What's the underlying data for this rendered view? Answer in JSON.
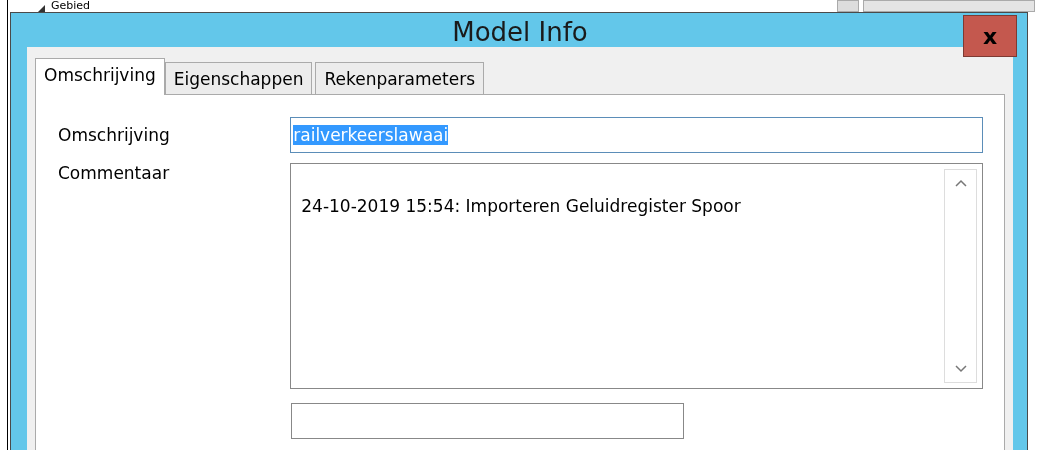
{
  "background": {
    "tree_item": "Gebied"
  },
  "window": {
    "title": "Model Info",
    "close": "x"
  },
  "tabs": [
    {
      "label": "Omschrijving",
      "selected": true
    },
    {
      "label": "Eigenschappen",
      "selected": false
    },
    {
      "label": "Rekenparameters",
      "selected": false
    }
  ],
  "form": {
    "description_label": "Omschrijving",
    "description_value": "railverkeerslawaai",
    "description_selected": true,
    "comment_label": "Commentaar",
    "comment_value": "24-10-2019 15:54: Importeren Geluidregister Spoor"
  }
}
